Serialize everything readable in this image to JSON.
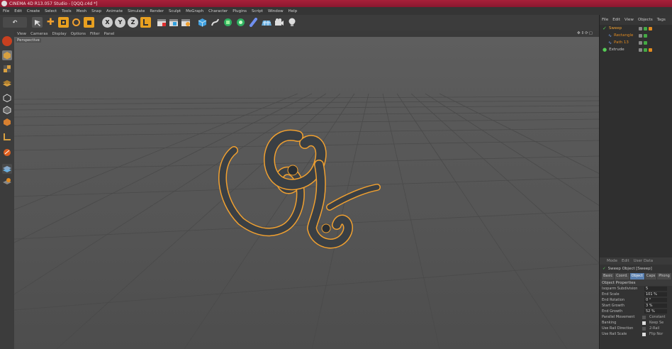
{
  "window": {
    "title": "CINEMA 4D R13.057 Studio - [QQQ.c4d *]"
  },
  "menubar": [
    "File",
    "Edit",
    "Create",
    "Select",
    "Tools",
    "Mesh",
    "Snap",
    "Animate",
    "Simulate",
    "Render",
    "Sculpt",
    "MoGraph",
    "Character",
    "Plugins",
    "Script",
    "Window",
    "Help"
  ],
  "toolbar": {
    "icons": [
      "undo-icon",
      "live-selection-icon",
      "move-icon",
      "scale-icon",
      "rotate-icon",
      "recent-tool-icon",
      "x-axis-icon",
      "y-axis-icon",
      "z-axis-icon",
      "world-coordinates-icon",
      "render-view-icon",
      "render-picture-viewer-icon",
      "edit-render-settings-icon",
      "cube-icon",
      "pen-icon",
      "subdivision-icon",
      "array-icon",
      "deformer-icon",
      "floor-icon",
      "camera-icon",
      "light-icon"
    ],
    "axis_labels": [
      "X",
      "Y",
      "Z"
    ]
  },
  "viewport": {
    "menu": [
      "View",
      "Cameras",
      "Display",
      "Options",
      "Filter",
      "Panel"
    ],
    "camera_label": "Perspective",
    "nav_glyphs": "✥⇕⟳▢"
  },
  "object_manager": {
    "menu": [
      "File",
      "Edit",
      "View",
      "Objects",
      "Tags"
    ],
    "objects": [
      {
        "name": "Sweep",
        "color": "#f0a030"
      },
      {
        "name": "Rectangle",
        "color": "#e08a20"
      },
      {
        "name": "Path 13",
        "color": "#e08a20"
      },
      {
        "name": "Extrude",
        "color": "#c8c8c8"
      }
    ]
  },
  "attribute_manager": {
    "menu": [
      "Mode",
      "Edit",
      "User Data"
    ],
    "object_title": "Sweep Object [Sweep]",
    "tabs": [
      "Basic",
      "Coord.",
      "Object",
      "Caps",
      "Phong"
    ],
    "active_tab": "Object",
    "section": "Object Properties",
    "fields": [
      {
        "label": "Isoparm Subdivision",
        "value": "5"
      },
      {
        "label": "End Scale",
        "value": "101 %"
      },
      {
        "label": "End Rotation",
        "value": "0 °"
      },
      {
        "label": "Start Growth",
        "value": "3 %"
      },
      {
        "label": "End Growth",
        "value": "52 %"
      }
    ],
    "checkboxes": [
      {
        "label": "Parallel Movement",
        "side": "Constant"
      },
      {
        "label": "Banking",
        "side": "Keep Se"
      },
      {
        "label": "Use Rail Direction",
        "side": "2-Rail"
      },
      {
        "label": "Use Rail Scale",
        "side": "Flip Nor"
      }
    ]
  },
  "colors": {
    "accent": "#f0a030",
    "title_bar": "#a8203a",
    "selection_outline": "#f0a030"
  }
}
